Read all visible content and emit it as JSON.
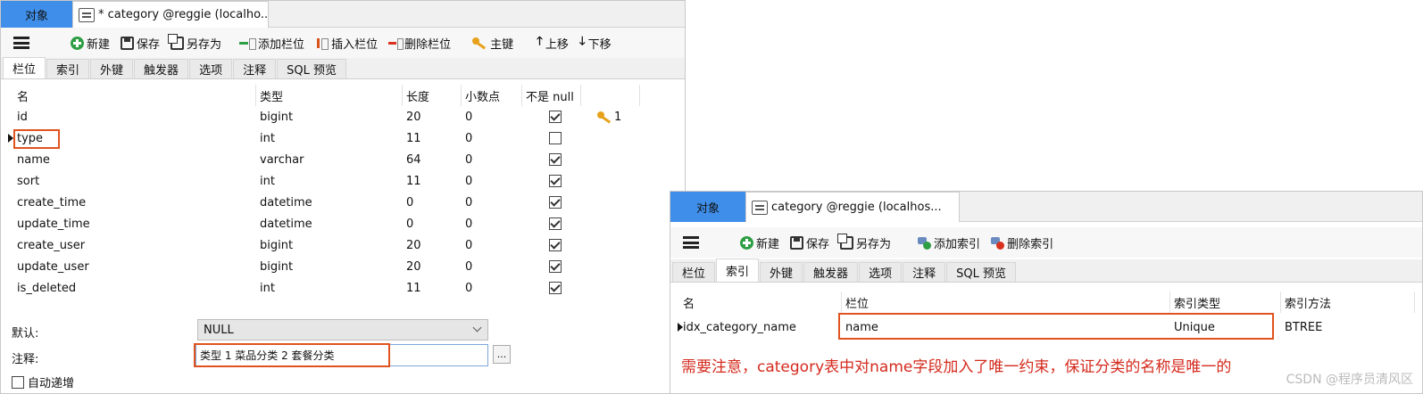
{
  "left_window": {
    "tabs": {
      "objects": "对象",
      "document": "* category @reggie (localho..."
    },
    "toolbar": {
      "new": "新建",
      "save": "保存",
      "save_as": "另存为",
      "add_column": "添加栏位",
      "insert_column": "插入栏位",
      "delete_column": "删除栏位",
      "primary_key": "主键",
      "move_up": "上移",
      "move_down": "下移"
    },
    "subtabs": [
      "栏位",
      "索引",
      "外键",
      "触发器",
      "选项",
      "注释",
      "SQL 预览"
    ],
    "columns_header": {
      "name": "名",
      "type": "类型",
      "length": "长度",
      "decimals": "小数点",
      "not_null": "不是 null"
    },
    "rows": [
      {
        "name": "id",
        "type": "bigint",
        "length": "20",
        "decimals": "0",
        "not_null": true,
        "key": "1"
      },
      {
        "name": "type",
        "type": "int",
        "length": "11",
        "decimals": "0",
        "not_null": false,
        "key": ""
      },
      {
        "name": "name",
        "type": "varchar",
        "length": "64",
        "decimals": "0",
        "not_null": true,
        "key": ""
      },
      {
        "name": "sort",
        "type": "int",
        "length": "11",
        "decimals": "0",
        "not_null": true,
        "key": ""
      },
      {
        "name": "create_time",
        "type": "datetime",
        "length": "0",
        "decimals": "0",
        "not_null": true,
        "key": ""
      },
      {
        "name": "update_time",
        "type": "datetime",
        "length": "0",
        "decimals": "0",
        "not_null": true,
        "key": ""
      },
      {
        "name": "create_user",
        "type": "bigint",
        "length": "20",
        "decimals": "0",
        "not_null": true,
        "key": ""
      },
      {
        "name": "update_user",
        "type": "bigint",
        "length": "20",
        "decimals": "0",
        "not_null": true,
        "key": ""
      },
      {
        "name": "is_deleted",
        "type": "int",
        "length": "11",
        "decimals": "0",
        "not_null": true,
        "key": ""
      }
    ],
    "properties": {
      "default_label": "默认:",
      "default_value": "NULL",
      "comment_label": "注释:",
      "comment_value": "类型   1 菜品分类 2 套餐分类",
      "comment_button": "...",
      "auto_increment_label": "自动递增"
    }
  },
  "right_window": {
    "tabs": {
      "objects": "对象",
      "document": "category @reggie (localhos..."
    },
    "toolbar": {
      "new": "新建",
      "save": "保存",
      "save_as": "另存为",
      "add_index": "添加索引",
      "delete_index": "删除索引"
    },
    "subtabs": [
      "栏位",
      "索引",
      "外键",
      "触发器",
      "选项",
      "注释",
      "SQL 预览"
    ],
    "index_header": {
      "name": "名",
      "fields": "栏位",
      "index_type": "索引类型",
      "index_method": "索引方法"
    },
    "index_rows": [
      {
        "name": "idx_category_name",
        "fields": "name",
        "index_type": "Unique",
        "index_method": "BTREE"
      }
    ],
    "note": "需要注意，category表中对name字段加入了唯一约束，保证分类的名称是唯一的",
    "watermark": "CSDN @程序员清风区"
  },
  "colors": {
    "accent_tab": "#3f8ee9",
    "highlight_box": "#e0531f",
    "note_text": "#d42a1d"
  },
  "icons": [
    "menu-icon",
    "new-icon",
    "save-icon",
    "save-as-icon",
    "add-column-icon",
    "insert-column-icon",
    "delete-column-icon",
    "key-icon",
    "arrow-up-icon",
    "arrow-down-icon",
    "add-index-icon",
    "delete-index-icon"
  ]
}
